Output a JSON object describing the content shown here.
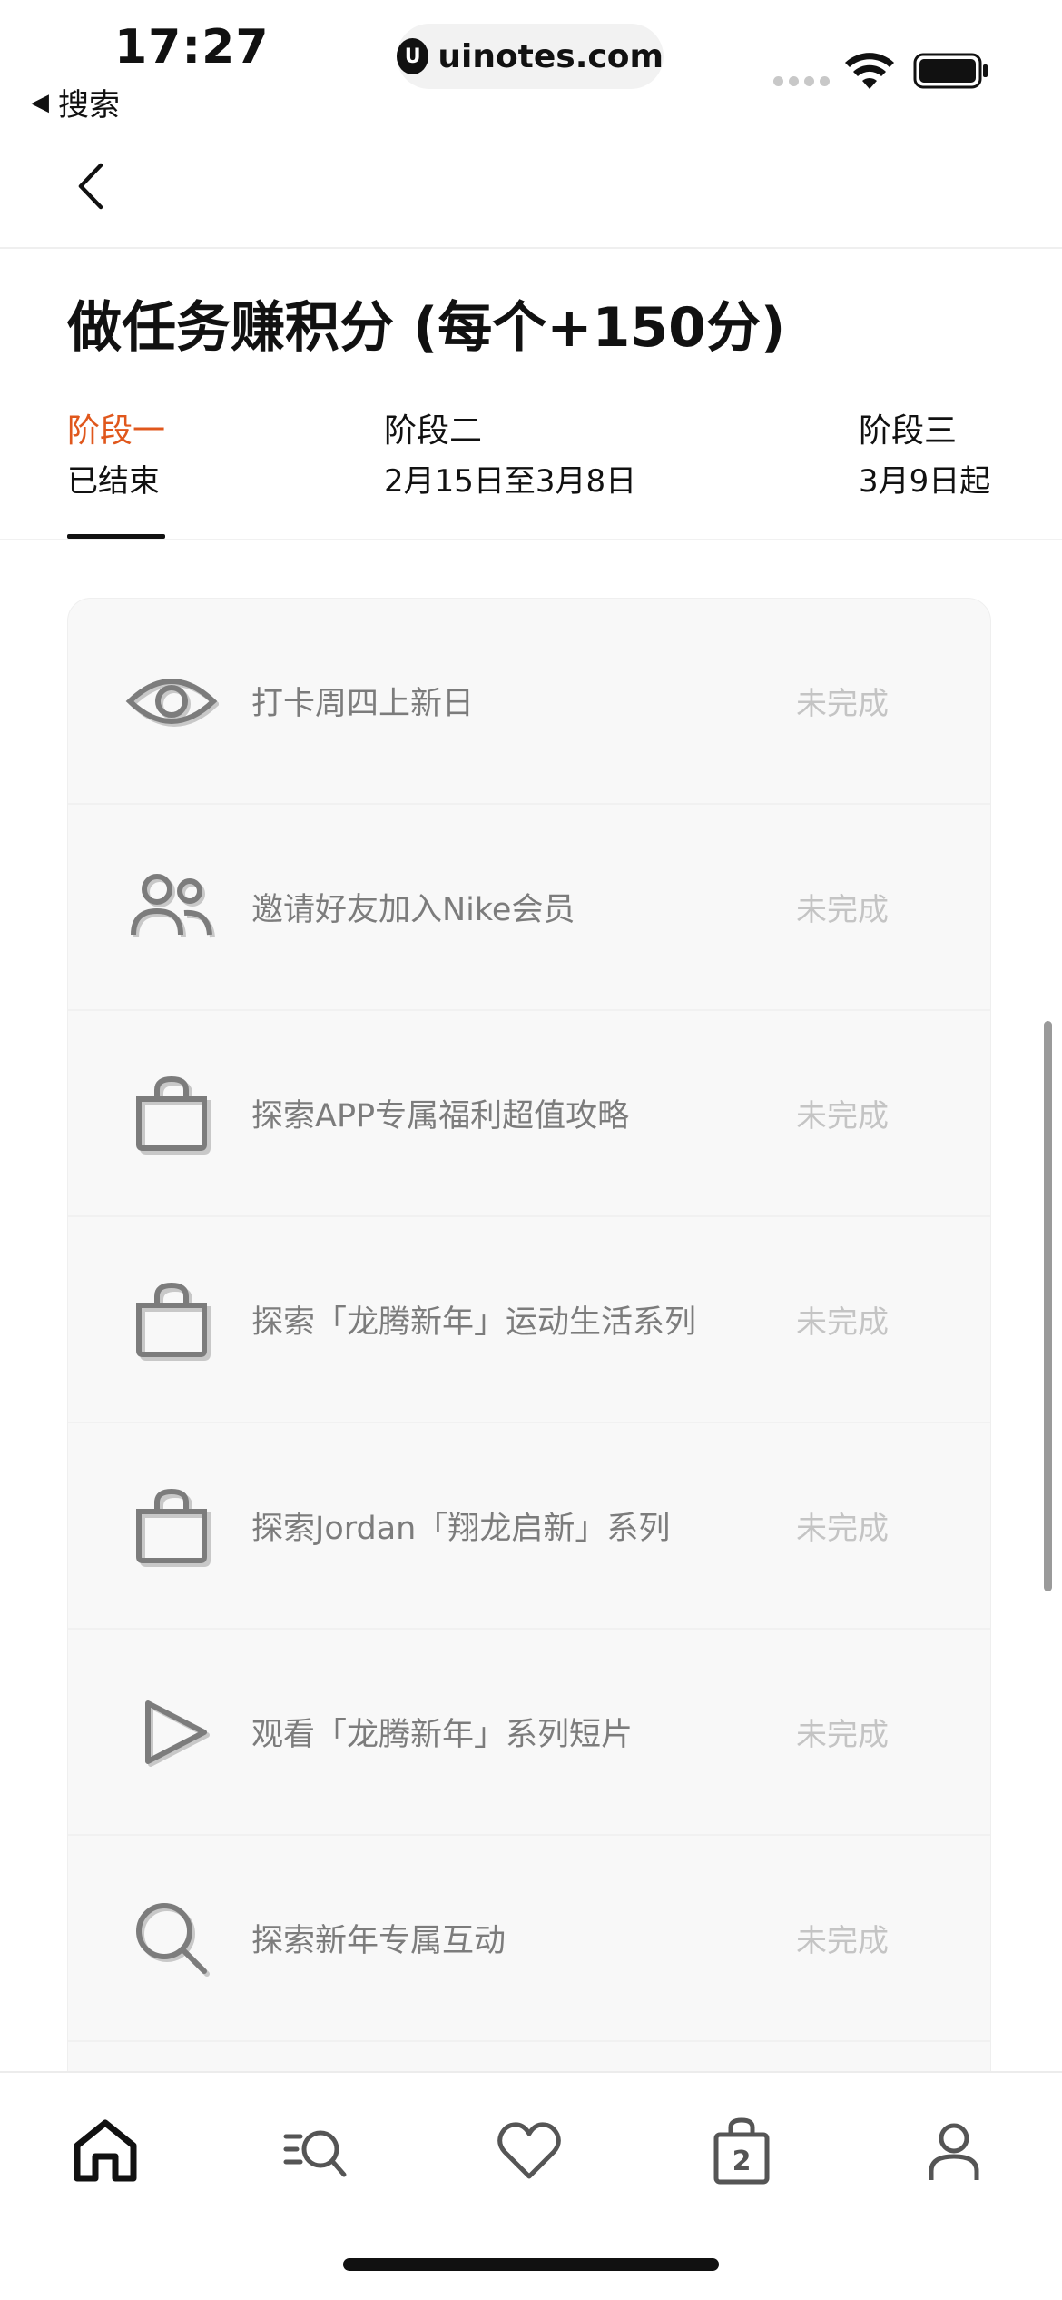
{
  "status_bar": {
    "time": "17:27",
    "back_app": "搜索",
    "url": "uinotes.com",
    "url_logo_letter": "U"
  },
  "title": "做任务赚积分 (每个+150分)",
  "tabs": [
    {
      "label": "阶段一",
      "sub": "已结束",
      "active": true
    },
    {
      "label": "阶段二",
      "sub": "2月15日至3月8日",
      "active": false
    },
    {
      "label": "阶段三",
      "sub": "3月9日起",
      "active": false
    }
  ],
  "tasks": [
    {
      "icon": "eye-icon",
      "label": "打卡周四上新日",
      "status": "未完成"
    },
    {
      "icon": "users-icon",
      "label": "邀请好友加入Nike会员",
      "status": "未完成"
    },
    {
      "icon": "shopping-bag-icon",
      "label": "探索APP专属福利超值攻略",
      "status": "未完成"
    },
    {
      "icon": "shopping-bag-icon",
      "label": "探索「龙腾新年」运动生活系列",
      "status": "未完成"
    },
    {
      "icon": "shopping-bag-icon",
      "label": "探索Jordan「翔龙启新」系列",
      "status": "未完成"
    },
    {
      "icon": "play-icon",
      "label": "观看「龙腾新年」系列短片",
      "status": "未完成"
    },
    {
      "icon": "search-icon",
      "label": "探索新年专属互动",
      "status": "未完成"
    }
  ],
  "tabbar": {
    "items": [
      {
        "icon": "home-icon"
      },
      {
        "icon": "search-list-icon"
      },
      {
        "icon": "heart-icon"
      },
      {
        "icon": "bag-icon",
        "badge": "2"
      },
      {
        "icon": "profile-icon"
      }
    ]
  },
  "colors": {
    "accent": "#e0571c",
    "text": "#111111",
    "muted": "#7c7c7c",
    "status_pending": "#c4c4c4"
  }
}
